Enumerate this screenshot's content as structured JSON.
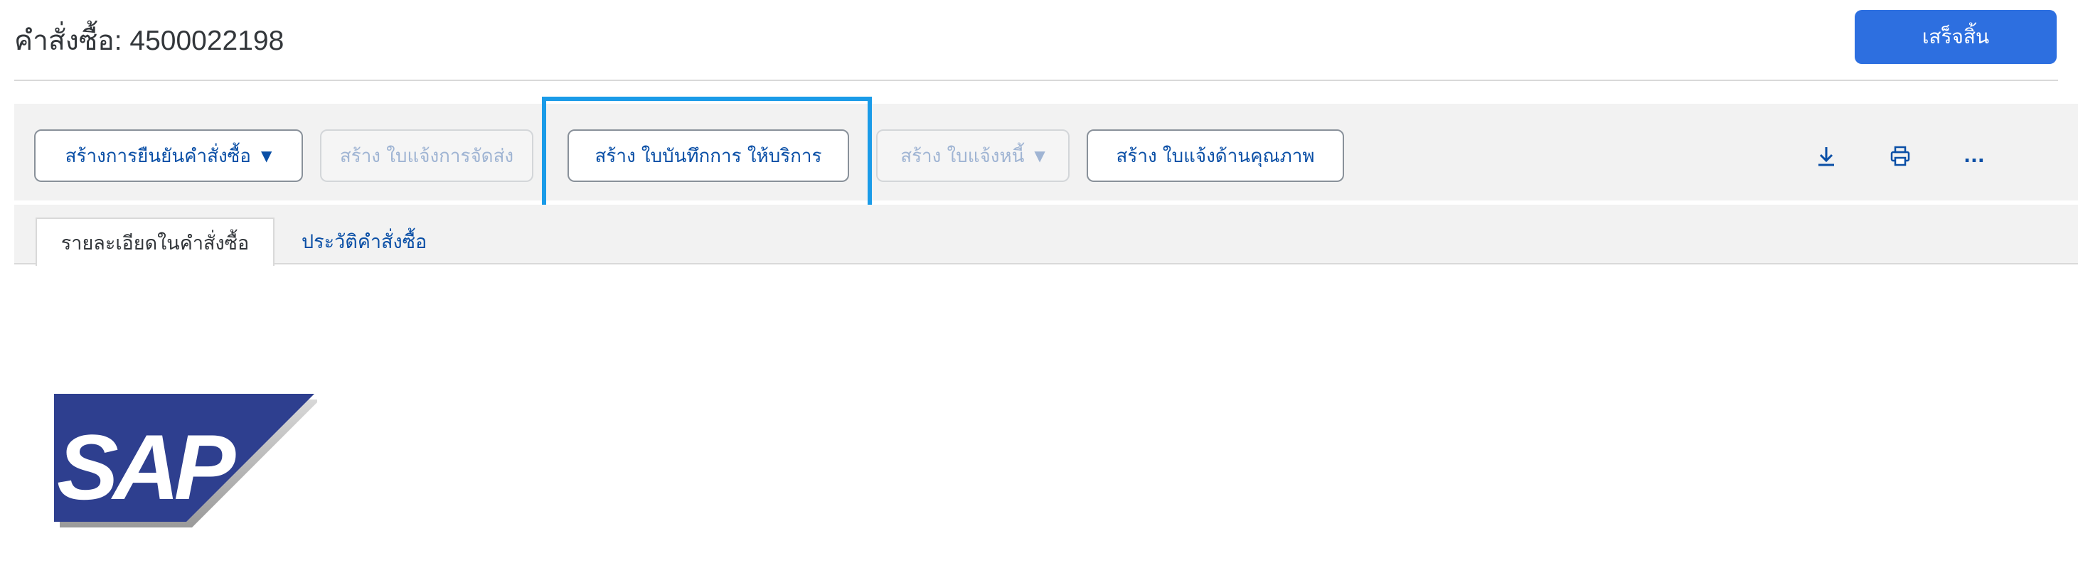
{
  "header": {
    "title": "คำสั่งซื้อ: 4500022198",
    "done_label": "เสร็จสิ้น"
  },
  "toolbar": {
    "buttons": [
      {
        "label": "สร้างการยืนยันคำสั่งซื้อ",
        "has_dropdown": true,
        "enabled": true
      },
      {
        "label": "สร้าง ใบแจ้งการจัดส่ง",
        "has_dropdown": false,
        "enabled": false
      },
      {
        "label": "สร้าง ใบบันทึกการ ให้บริการ",
        "has_dropdown": false,
        "enabled": true,
        "highlighted": true
      },
      {
        "label": "สร้าง ใบแจ้งหนี้",
        "has_dropdown": true,
        "enabled": false
      },
      {
        "label": "สร้าง ใบแจ้งด้านคุณภาพ",
        "has_dropdown": false,
        "enabled": true
      }
    ],
    "caret": "▼",
    "icons": [
      "download-icon",
      "print-icon",
      "more-icon"
    ],
    "more_glyph": "..."
  },
  "tabs": [
    {
      "label": "รายละเอียดในคำสั่งซื้อ",
      "active": true
    },
    {
      "label": "ประวัติคำสั่งซื้อ",
      "active": false
    }
  ],
  "logo": {
    "text": "SAP"
  },
  "colors": {
    "accent": "#2d6fe0",
    "link": "#0a4fa6",
    "highlight": "#1a9be8",
    "toolbar_bg": "#f2f2f2",
    "logo_blue": "#2e3f8f"
  }
}
